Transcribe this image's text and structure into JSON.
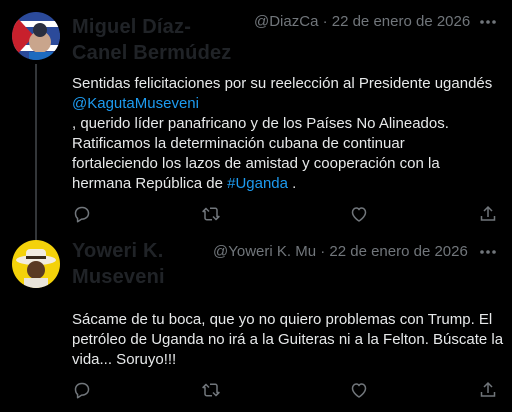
{
  "tweets": [
    {
      "author_name": "Miguel Díaz-Canel Bermúdez",
      "meta": "@DiazCa · 22 de enero de 2026",
      "text_before_link": "Sentidas felicitaciones por su reelección al Presidente ugandés",
      "mention": "@KagutaMuseveni",
      "text_after_mention_1": ", querido líder panafricano y de los Países No Alineados.",
      "text_after_mention_2": "Ratificamos la determinación cubana de continuar",
      "text_after_mention_3": "fortaleciendo los lazos de amistad y cooperación con la",
      "text_last_prefix": "hermana República de ",
      "hashtag": "#Uganda",
      "text_last_suffix": " .",
      "avatar_icon": "flag-avatar-icon"
    },
    {
      "author_name": "Yoweri K. Museveni",
      "meta": "@Yoweri K. Mu · 22 de enero de 2026",
      "line_1": "Sácame de tu boca, que yo no quiero problemas con Trump. El",
      "line_2": "petróleo de Uganda no irá a la Guiteras ni a la Felton. Búscate la",
      "line_3": "vida... Soruyo!!!",
      "avatar_icon": "hat-avatar-icon"
    }
  ],
  "colors": {
    "background": "#000000",
    "text": "#e7e9ea",
    "muted": "#71767b",
    "link": "#1d9bf0",
    "author_name": "#202327"
  },
  "icons": [
    "reply-icon",
    "retweet-icon",
    "like-icon",
    "share-icon",
    "more-icon"
  ]
}
